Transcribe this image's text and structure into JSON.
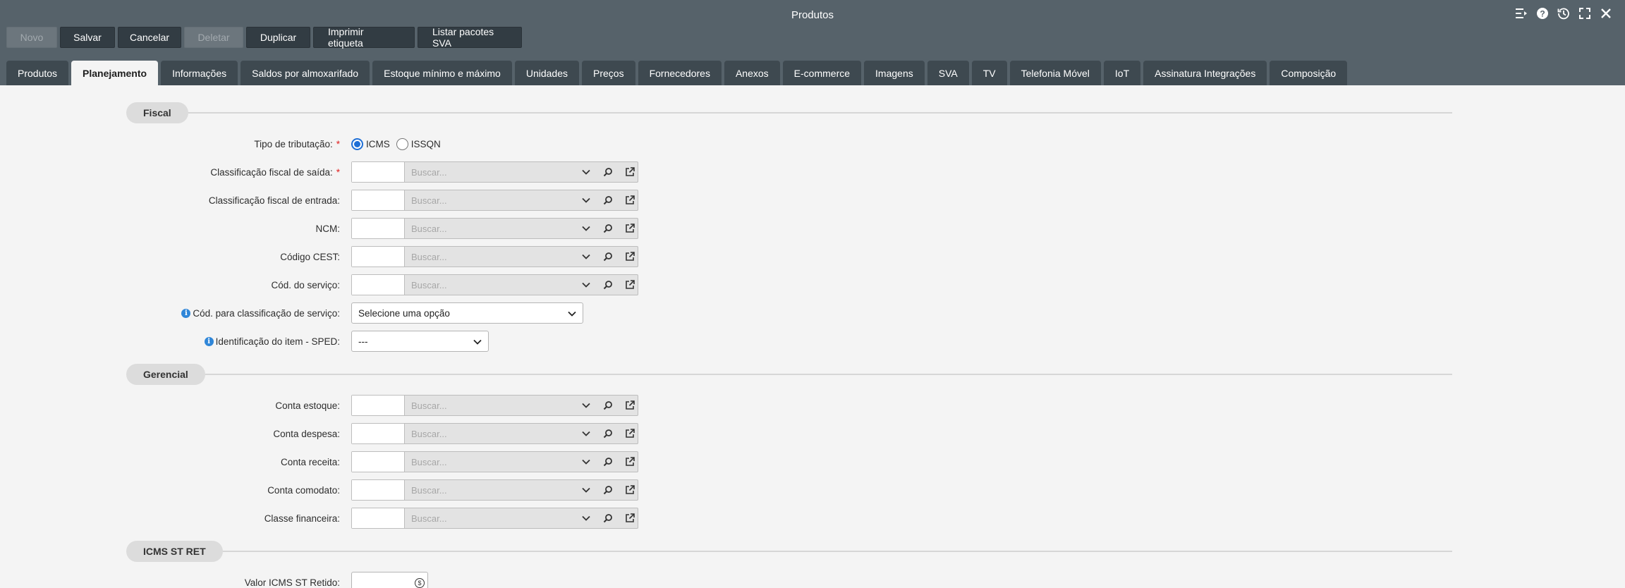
{
  "window": {
    "title": "Produtos",
    "icons": [
      "collapse-menu-icon",
      "help-icon",
      "history-icon",
      "maximize-icon",
      "close-icon"
    ]
  },
  "toolbar": {
    "novo": "Novo",
    "salvar": "Salvar",
    "cancelar": "Cancelar",
    "deletar": "Deletar",
    "duplicar": "Duplicar",
    "imprimir_etiqueta": "Imprimir etiqueta",
    "listar_pacotes_sva": "Listar pacotes SVA"
  },
  "tabs": [
    {
      "label": "Produtos",
      "active": false
    },
    {
      "label": "Planejamento",
      "active": true
    },
    {
      "label": "Informações",
      "active": false
    },
    {
      "label": "Saldos por almoxarifado",
      "active": false
    },
    {
      "label": "Estoque mínimo e máximo",
      "active": false
    },
    {
      "label": "Unidades",
      "active": false
    },
    {
      "label": "Preços",
      "active": false
    },
    {
      "label": "Fornecedores",
      "active": false
    },
    {
      "label": "Anexos",
      "active": false
    },
    {
      "label": "E-commerce",
      "active": false
    },
    {
      "label": "Imagens",
      "active": false
    },
    {
      "label": "SVA",
      "active": false
    },
    {
      "label": "TV",
      "active": false
    },
    {
      "label": "Telefonia Móvel",
      "active": false
    },
    {
      "label": "IoT",
      "active": false
    },
    {
      "label": "Assinatura Integrações",
      "active": false
    },
    {
      "label": "Composição",
      "active": false
    }
  ],
  "fiscal": {
    "title": "Fiscal",
    "tipo_tributacao": {
      "label": "Tipo de tributação:",
      "options": [
        {
          "label": "ICMS",
          "selected": true
        },
        {
          "label": "ISSQN",
          "selected": false
        }
      ]
    },
    "classificacao_saida": {
      "label": "Classificação fiscal de saída:",
      "code": "",
      "placeholder": "Buscar..."
    },
    "classificacao_entrada": {
      "label": "Classificação fiscal de entrada:",
      "code": "",
      "placeholder": "Buscar..."
    },
    "ncm": {
      "label": "NCM:",
      "code": "",
      "placeholder": "Buscar..."
    },
    "codigo_cest": {
      "label": "Código CEST:",
      "code": "",
      "placeholder": "Buscar..."
    },
    "cod_servico": {
      "label": "Cód. do serviço:",
      "code": "",
      "placeholder": "Buscar..."
    },
    "cod_classificacao_servico": {
      "label": "Cód. para classificação de serviço:",
      "value": "Selecione uma opção"
    },
    "identificacao_item_sped": {
      "label": "Identificação do item - SPED:",
      "value": "---"
    }
  },
  "gerencial": {
    "title": "Gerencial",
    "conta_estoque": {
      "label": "Conta estoque:",
      "code": "",
      "placeholder": "Buscar..."
    },
    "conta_despesa": {
      "label": "Conta despesa:",
      "code": "",
      "placeholder": "Buscar..."
    },
    "conta_receita": {
      "label": "Conta receita:",
      "code": "",
      "placeholder": "Buscar..."
    },
    "conta_comodato": {
      "label": "Conta comodato:",
      "code": "",
      "placeholder": "Buscar..."
    },
    "classe_financeira": {
      "label": "Classe financeira:",
      "code": "",
      "placeholder": "Buscar..."
    }
  },
  "icms_st_ret": {
    "title": "ICMS ST RET",
    "valor_icms_st_retido": {
      "label": "Valor ICMS ST Retido:",
      "value": "",
      "currency_icon": "$"
    }
  }
}
